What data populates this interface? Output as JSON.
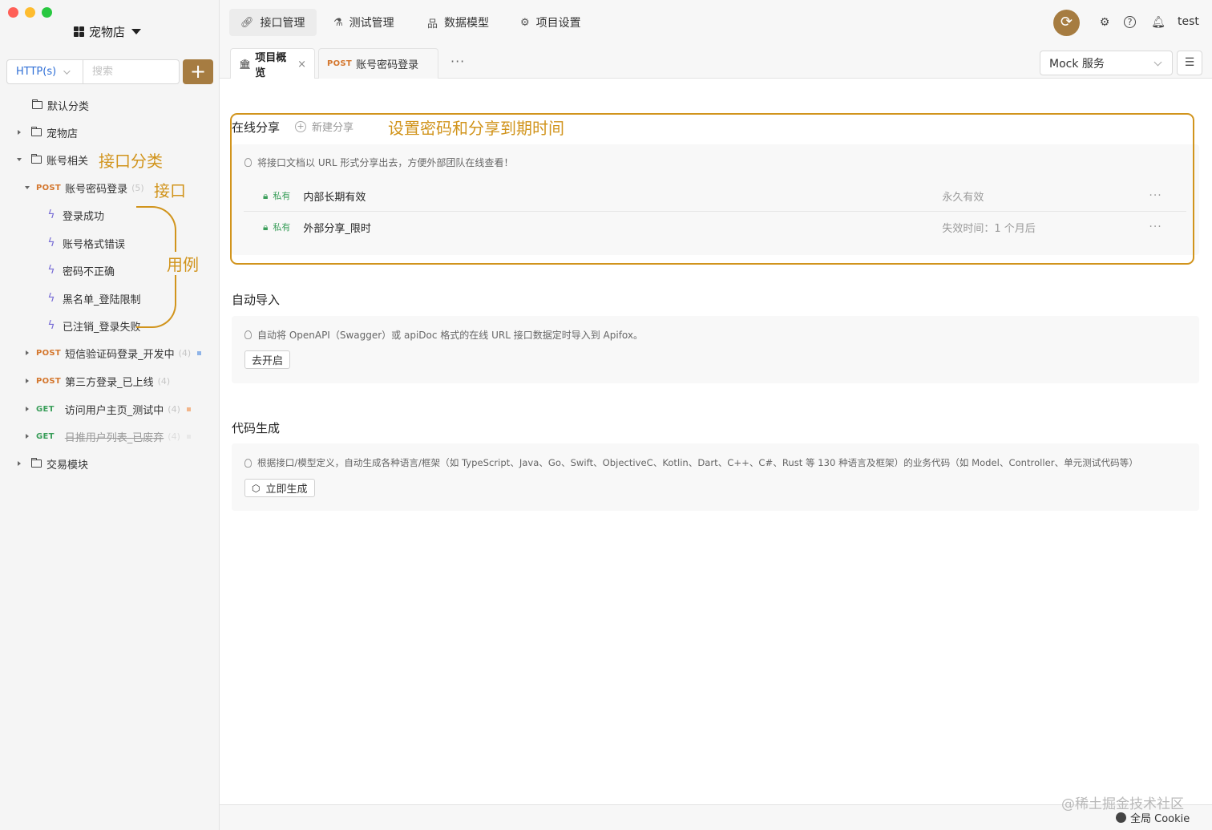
{
  "sidebar": {
    "project_name": "宠物店",
    "protocol": "HTTP(s)",
    "search_placeholder": "搜索",
    "add_label": "+",
    "tree": {
      "default_category": "默认分类",
      "petstore": "宠物店",
      "account": "账号相关",
      "login_api": {
        "method": "POST",
        "name": "账号密码登录",
        "count": "(5)"
      },
      "cases": [
        "登录成功",
        "账号格式错误",
        "密码不正确",
        "黑名单_登陆限制",
        "已注销_登录失败"
      ],
      "apis": [
        {
          "method": "POST",
          "name": "短信验证码登录_开发中",
          "count": "(4)",
          "status_color": "#8fb4e8"
        },
        {
          "method": "POST",
          "name": "第三方登录_已上线",
          "count": "(4)",
          "status_color": ""
        },
        {
          "method": "GET",
          "name": "访问用户主页_测试中",
          "count": "(4)",
          "status_color": "#f2b58a"
        },
        {
          "method": "GET",
          "name": "日推用户列表_已废弃",
          "count": "(4)",
          "status_color": "#dddddd"
        }
      ],
      "trade": "交易模块"
    },
    "annotations": {
      "category": "接口分类",
      "api": "接口",
      "case": "用例"
    }
  },
  "topnav": {
    "tabs": [
      {
        "label": "接口管理",
        "icon": "link-icon"
      },
      {
        "label": "测试管理",
        "icon": "flask-icon"
      },
      {
        "label": "数据模型",
        "icon": "schema-icon"
      },
      {
        "label": "项目设置",
        "icon": "gear-icon"
      }
    ],
    "user": "test"
  },
  "tabbar": {
    "overview_tab": "项目概览",
    "api_tab_method": "POST",
    "api_tab_name": "账号密码登录",
    "more": "···",
    "mock": "Mock 服务"
  },
  "content": {
    "share": {
      "title": "在线分享",
      "new_label": "新建分享",
      "annotation": "设置密码和分享到期时间",
      "hint": "将接口文档以 URL 形式分享出去，方便外部团队在线查看！",
      "rows": [
        {
          "privacy": "私有",
          "name": "内部长期有效",
          "expiry": "永久有效"
        },
        {
          "privacy": "私有",
          "name": "外部分享_限时",
          "expiry": "失效时间：1 个月后"
        }
      ],
      "row_more": "···"
    },
    "import": {
      "title": "自动导入",
      "hint": "自动将 OpenAPI（Swagger）或 apiDoc 格式的在线 URL 接口数据定时导入到 Apifox。",
      "button": "去开启"
    },
    "codegen": {
      "title": "代码生成",
      "hint": "根据接口/模型定义，自动生成各种语言/框架（如 TypeScript、Java、Go、Swift、ObjectiveC、Kotlin、Dart、C++、C#、Rust 等 130 种语言及框架）的业务代码（如 Model、Controller、单元测试代码等）",
      "button": "立即生成"
    }
  },
  "footer": {
    "watermark": "@稀土掘金技术社区",
    "cookie": "全局 Cookie"
  },
  "colors": {
    "accent": "#a67c41",
    "annotation": "#d1941c",
    "post": "#d4772e",
    "get": "#3a9e5a"
  }
}
